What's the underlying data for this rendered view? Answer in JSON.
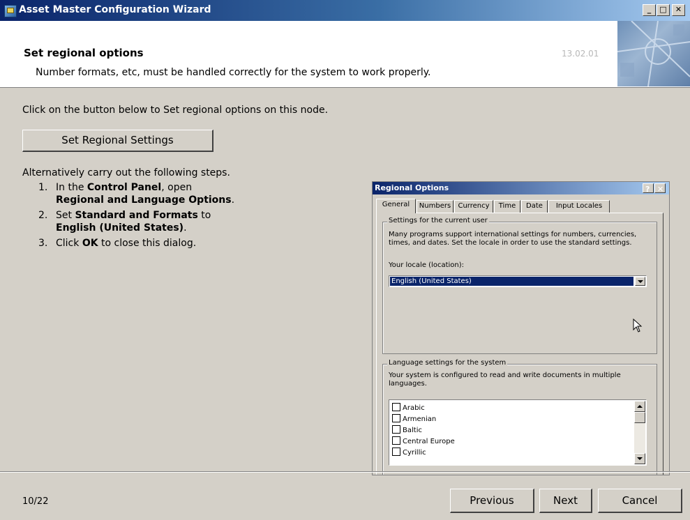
{
  "window": {
    "title": "Asset Master  Configuration Wizard",
    "controls": {
      "minimize": "_",
      "maximize": "□",
      "close": "✕"
    }
  },
  "header": {
    "title": "Set regional options",
    "subtitle": "Number formats, etc, must be handled correctly for the system to work properly.",
    "version": "13.02.01"
  },
  "content": {
    "intro": "Click on the button below to Set regional options on this node.",
    "set_button_label": "Set Regional Settings",
    "alt_text": "Alternatively carry out the following steps.",
    "steps": [
      {
        "num": "1.",
        "pre": "In the ",
        "b1": "Control Panel",
        "mid": ", open ",
        "b2": "Regional and Language Options",
        "post": "."
      },
      {
        "num": "2.",
        "pre": "Set ",
        "b1": "Standard and Formats",
        "mid": " to ",
        "b2": "English (United States)",
        "post": "."
      },
      {
        "num": "3.",
        "pre": "Click ",
        "b1": "OK",
        "mid": " to close this dialog.",
        "b2": "",
        "post": ""
      }
    ]
  },
  "regional_options": {
    "title": "Regional Options",
    "help": "?",
    "close": "✕",
    "tabs": [
      "General",
      "Numbers",
      "Currency",
      "Time",
      "Date",
      "Input Locales"
    ],
    "user_group_label": "Settings for the current user",
    "user_group_desc": "Many programs support international settings for numbers, currencies, times, and dates. Set the locale in order to use the standard settings.",
    "locale_label": "Your locale (location):",
    "locale_value": "English (United States)",
    "lang_group_label": "Language settings for the system",
    "lang_group_desc": "Your system is configured to read and write documents in multiple languages.",
    "languages": [
      "Arabic",
      "Armenian",
      "Baltic",
      "Central Europe",
      "Cyrillic"
    ]
  },
  "footer": {
    "page_indicator": "10/22",
    "previous_label": "Previous",
    "next_label": "Next",
    "cancel_label": "Cancel"
  }
}
